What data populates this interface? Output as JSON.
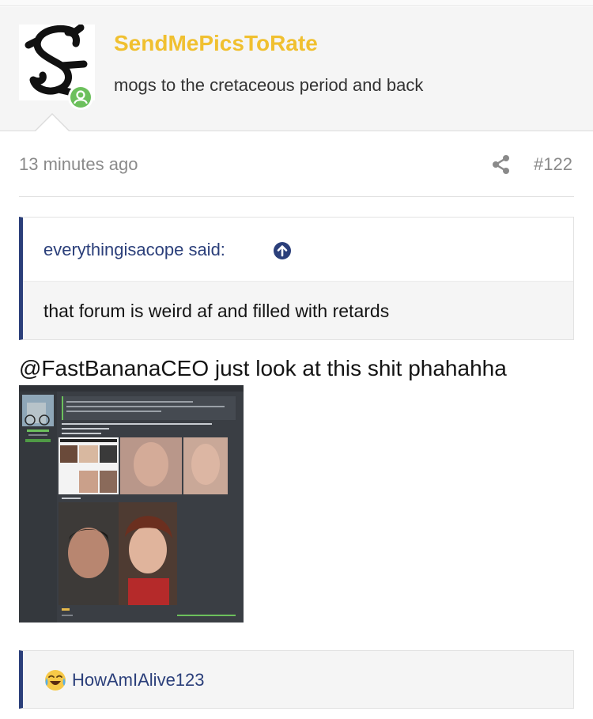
{
  "header": {
    "username": "SendMePicsToRate",
    "user_title": "mogs to the cretaceous period and back",
    "avatar_letter": "S"
  },
  "post": {
    "timestamp": "13 minutes ago",
    "post_number": "#122",
    "quote": {
      "author": "everythingisacope said:",
      "text": "that forum is weird af and filled with retards"
    },
    "body_text": "@FastBananaCEO just look at this shit phahahha",
    "next_quote": {
      "author": "HowAmIAlive123"
    }
  },
  "colors": {
    "username": "#f0c030",
    "quote_accent": "#2b3f7a",
    "online": "#6cc05c"
  },
  "icons": [
    "share-icon",
    "arrow-up-circle-icon",
    "crying-laughing-emoji",
    "online-status-icon"
  ]
}
